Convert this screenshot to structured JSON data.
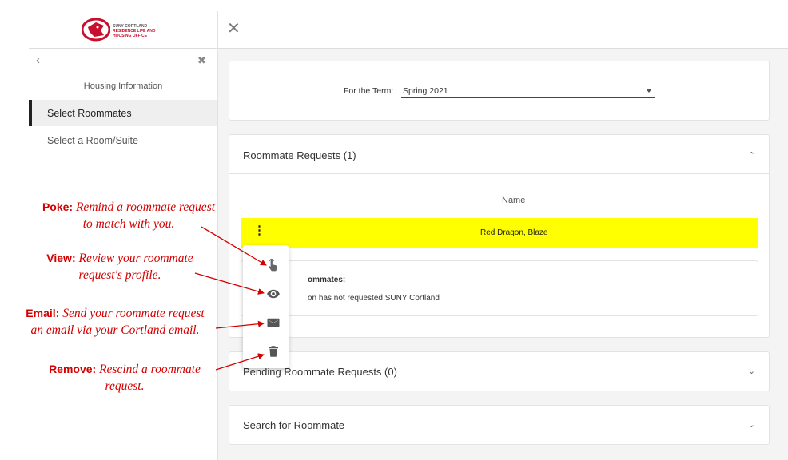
{
  "sidebar": {
    "logo_line1": "SUNY CORTLAND",
    "logo_line2": "RESIDENCE LIFE AND",
    "logo_line3": "HOUSING OFFICE",
    "items": [
      {
        "label": "Housing Information"
      },
      {
        "label": "Select Roommates"
      },
      {
        "label": "Select a Room/Suite"
      }
    ]
  },
  "term": {
    "label": "For the Term:",
    "selected": "Spring 2021"
  },
  "roommate_requests": {
    "title": "Roommate Requests (1)",
    "column_header": "Name",
    "rows": [
      {
        "name": "Red Dragon, Blaze"
      }
    ],
    "info_heading": "ommates:",
    "info_text": "on has not requested SUNY Cortland"
  },
  "pending": {
    "title": "Pending Roommate Requests (0)"
  },
  "search": {
    "title": "Search for Roommate"
  },
  "annotations": {
    "poke_title": "Poke:",
    "poke_text_1": "Remind a roommate request",
    "poke_text_2": "to match with you.",
    "view_title": "View:",
    "view_text_1": "Review your roommate",
    "view_text_2": "request's profile.",
    "email_title": "Email:",
    "email_text_1": "Send your roommate request",
    "email_text_2": "an email via your Cortland email.",
    "remove_title": "Remove:",
    "remove_text_1": "Rescind a roommate",
    "remove_text_2": "request."
  },
  "colors": {
    "highlight": "#ffff00",
    "annotation": "#d40000",
    "brand": "#c8102e"
  },
  "icons": [
    "poke-icon",
    "eye-icon",
    "mail-icon",
    "trash-icon",
    "close-icon",
    "chevron-left-icon",
    "chevron-up-icon",
    "chevron-down-icon",
    "kebab-icon"
  ]
}
